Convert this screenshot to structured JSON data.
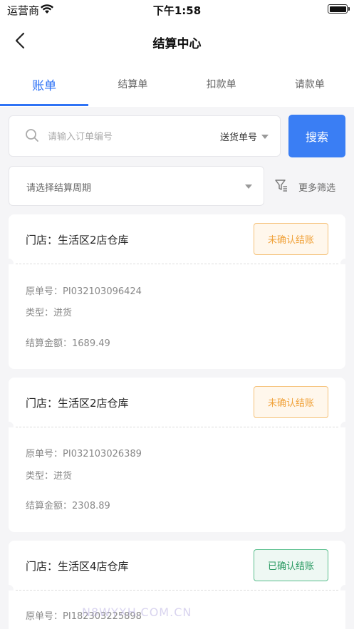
{
  "status_bar": {
    "carrier": "运营商",
    "time": "下午1:58"
  },
  "nav": {
    "title": "结算中心"
  },
  "tabs": [
    {
      "label": "账单",
      "active": true
    },
    {
      "label": "结算单",
      "active": false
    },
    {
      "label": "扣款单",
      "active": false
    },
    {
      "label": "请款单",
      "active": false
    }
  ],
  "search": {
    "placeholder": "请输入订单编号",
    "type_selected": "送货单号",
    "button_label": "搜索"
  },
  "filters": {
    "period_placeholder": "请选择结算周期",
    "more_label": "更多筛选"
  },
  "bills": [
    {
      "store_label": "门店：",
      "store": "生活区2店仓库",
      "status": "未确认结账",
      "status_type": "pending",
      "order_label": "原单号：",
      "order_no": "PI032103096424",
      "type_label": "类型：",
      "type": "进货",
      "amount_label": "结算金额：",
      "amount": "1689.49"
    },
    {
      "store_label": "门店：",
      "store": "生活区2店仓库",
      "status": "未确认结账",
      "status_type": "pending",
      "order_label": "原单号：",
      "order_no": "PI032103026389",
      "type_label": "类型：",
      "type": "进货",
      "amount_label": "结算金额：",
      "amount": "2308.89"
    },
    {
      "store_label": "门店：",
      "store": "生活区4店仓库",
      "status": "已确认结账",
      "status_type": "done",
      "order_label": "原单号：",
      "order_no": "PI182303225898"
    }
  ],
  "watermark": "N8WYXH.COM.CN",
  "colors": {
    "accent": "#2f73f5",
    "pending": "#f0a23a",
    "done": "#2a9a62"
  }
}
